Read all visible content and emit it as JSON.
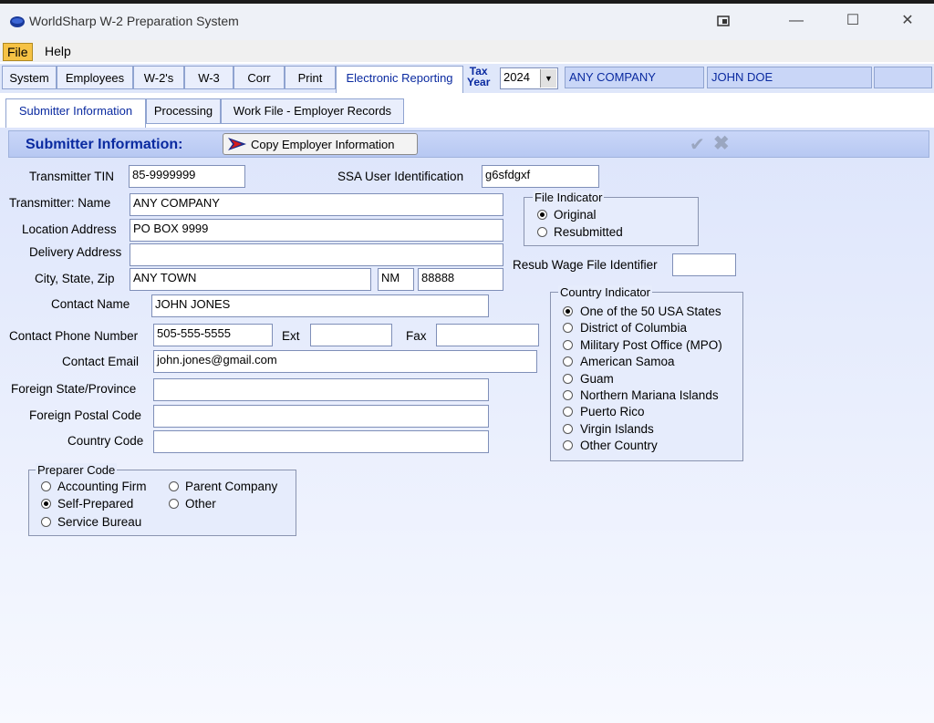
{
  "window": {
    "title": "WorldSharp W-2 Preparation System"
  },
  "menu": {
    "file": "File",
    "help": "Help"
  },
  "top_tabs": [
    {
      "label": "System"
    },
    {
      "label": "Employees"
    },
    {
      "label": "W-2's"
    },
    {
      "label": "W-3"
    },
    {
      "label": "Corr"
    },
    {
      "label": "Print"
    },
    {
      "label": "Electronic Reporting"
    }
  ],
  "tax_year": {
    "label_line1": "Tax",
    "label_line2": "Year",
    "value": "2024"
  },
  "company_display": "ANY COMPANY",
  "employee_display": "JOHN DOE",
  "sub_tabs": [
    {
      "label": "Submitter Information"
    },
    {
      "label": "Processing"
    },
    {
      "label": "Work File - Employer Records"
    }
  ],
  "section": {
    "title": "Submitter Information:",
    "copy_button": "Copy Employer Information"
  },
  "form": {
    "transmitter_tin": {
      "label": "Transmitter TIN",
      "value": "85-9999999"
    },
    "ssa_user_id": {
      "label": "SSA User Identification",
      "value": "g6sfdgxf"
    },
    "transmitter_name": {
      "label": "Transmitter:  Name",
      "value": "ANY COMPANY"
    },
    "location_address": {
      "label": "Location Address",
      "value": "PO BOX 9999"
    },
    "delivery_address": {
      "label": "Delivery Address",
      "value": ""
    },
    "city_state_zip": {
      "label": "City, State, Zip",
      "city": "ANY TOWN",
      "state": "NM",
      "zip": "88888"
    },
    "contact_name": {
      "label": "Contact Name",
      "value": "JOHN JONES"
    },
    "contact_phone": {
      "label": "Contact Phone Number",
      "value": "505-555-5555"
    },
    "ext": {
      "label": "Ext",
      "value": ""
    },
    "fax": {
      "label": "Fax",
      "value": ""
    },
    "contact_email": {
      "label": "Contact Email",
      "value": "john.jones@gmail.com"
    },
    "foreign_state": {
      "label": "Foreign State/Province",
      "value": ""
    },
    "foreign_postal": {
      "label": "Foreign Postal Code",
      "value": ""
    },
    "country_code": {
      "label": "Country Code",
      "value": ""
    },
    "resub_wfid": {
      "label": "Resub Wage File Identifier",
      "value": ""
    }
  },
  "file_indicator": {
    "title": "File Indicator",
    "options": [
      "Original",
      "Resubmitted"
    ],
    "selected": "Original"
  },
  "country_indicator": {
    "title": "Country Indicator",
    "options": [
      "One of the 50 USA States",
      "District of Columbia",
      "Military Post Office (MPO)",
      "American Samoa",
      "Guam",
      "Northern Mariana Islands",
      "Puerto Rico",
      "Virgin Islands",
      "Other Country"
    ],
    "selected": "One of the 50 USA States"
  },
  "preparer_code": {
    "title": "Preparer Code",
    "options": [
      "Accounting Firm",
      "Parent Company",
      "Self-Prepared",
      "Other",
      "Service Bureau"
    ],
    "selected": "Self-Prepared"
  },
  "icons": {
    "app": "globe-icon",
    "copy": "arrow-right-icon",
    "accept": "checkmark-icon",
    "cancel": "x-icon"
  },
  "colors": {
    "accent": "#0a2aa0",
    "panel": "#dde5fb",
    "menu_highlight": "#f6c244"
  }
}
